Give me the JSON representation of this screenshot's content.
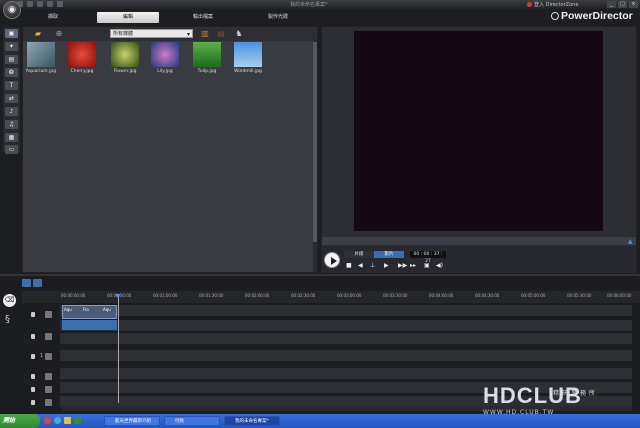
{
  "window": {
    "title": "我的未命名專案*",
    "login_label": "登入 DirectorZone",
    "minimize": "_",
    "maximize": "□",
    "close": "×"
  },
  "brand": {
    "name": "PowerDirector"
  },
  "tabs": [
    {
      "label": "擷取",
      "active": false
    },
    {
      "label": "編輯",
      "active": true
    },
    {
      "label": "輸出檔案",
      "active": false
    },
    {
      "label": "製作光碟",
      "active": false
    }
  ],
  "library": {
    "filter_selected": "所有媒體",
    "items": [
      {
        "name": "Aquarium.jpg",
        "color": "#5e7f8a"
      },
      {
        "name": "Cherry.jpg",
        "color": "#c8201e"
      },
      {
        "name": "Flower.jpg",
        "color": "#6f8a24"
      },
      {
        "name": "Lily.jpg",
        "color": "#4c5fbd"
      },
      {
        "name": "Tulip.jpg",
        "color": "#3f9a3a"
      },
      {
        "name": "Windmill.jpg",
        "color": "#5d96d8"
      }
    ]
  },
  "preview": {
    "clip_label": "片段",
    "movie_label": "影片",
    "timecode": "00 : 00 : 37 : 27"
  },
  "timeline": {
    "ticks": [
      "00:00:00:00",
      "00:00:30:00",
      "00:01:00:00",
      "00:01:30:00",
      "00:02:00:00",
      "00:02:30:00",
      "00:03:00:00",
      "00:03:30:00",
      "00:04:00:00",
      "00:04:30:00",
      "00:05:00:00",
      "00:05:30:00",
      "00:06:00:00"
    ],
    "clip_labels": [
      "Aqu",
      "Flo",
      "Aqu"
    ],
    "track_number": "1"
  },
  "taskbar": {
    "start_label": "開始",
    "items": [
      {
        "label": "藍光世界最新介紹",
        "active": false
      },
      {
        "label": "付款",
        "active": false
      },
      {
        "label": "我的未命名專案*",
        "active": true
      }
    ]
  },
  "watermark": {
    "logo": "HDCLUB",
    "chinese": "精研事務所",
    "url": "WWW.HD.CLUB.TW"
  },
  "colors": {
    "accent": "#3c6fae",
    "screen": "#140912"
  }
}
